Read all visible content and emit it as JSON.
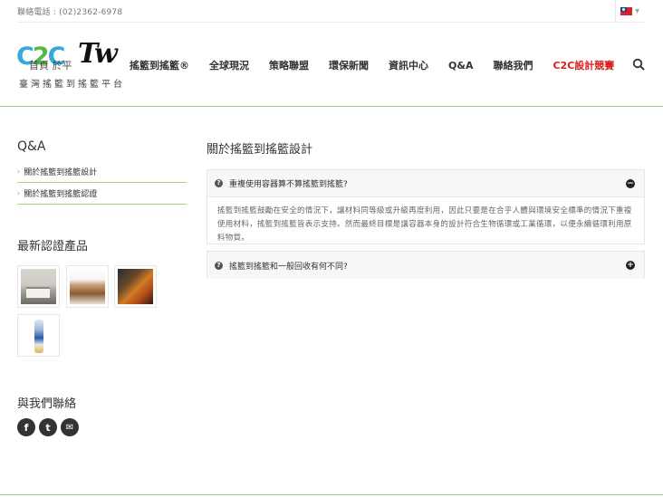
{
  "topbar": {
    "phone": "聯絡電話 : (02)2362-6978",
    "language_flag": "taiwan-flag-icon"
  },
  "logo": {
    "c2c_prefix": "C",
    "c2c_two": "2",
    "c2c_suffix": "C",
    "tw": "Tw",
    "subtitle": "臺灣搖籃到搖籃平台",
    "overlap_text": "首頁 於平"
  },
  "nav": {
    "items": [
      "搖籃到搖籃®",
      "全球現況",
      "策略聯盟",
      "環保新聞",
      "資訊中心",
      "Q&A",
      "聯絡我們"
    ],
    "highlight": "C2C設計競賽",
    "search_icon": "search-icon"
  },
  "sidebar": {
    "title": "Q&A",
    "items": [
      "關於搖籃到搖籃設計",
      "關於搖籃到搖籃認證"
    ],
    "products_title": "最新認證產品",
    "contact_title": "與我們聯絡",
    "social": [
      "f",
      "t",
      "✉"
    ]
  },
  "main": {
    "title": "關於搖籃到搖籃設計",
    "faq": [
      {
        "question": "重複使用容器算不算搖籃到搖籃?",
        "answer": "搖籃到搖籃鼓勵在安全的情況下，讓材料同等級或升級再度利用，因此只要是在合乎人體與環境安全標準的情況下重複使用材料，搖籃到搖籃皆表示支持。然而最終目標是讓容器本身的設計符合生物循環或工業循環，以便永續循環利用原料物質。",
        "expanded": true
      },
      {
        "question": "搖籃到搖籃和一般回收有何不同?",
        "expanded": false
      }
    ]
  },
  "colors": {
    "accent_green": "#9ed27a",
    "highlight_red": "#d71f1f",
    "logo_blue": "#37a8d7",
    "logo_green": "#56b947"
  }
}
